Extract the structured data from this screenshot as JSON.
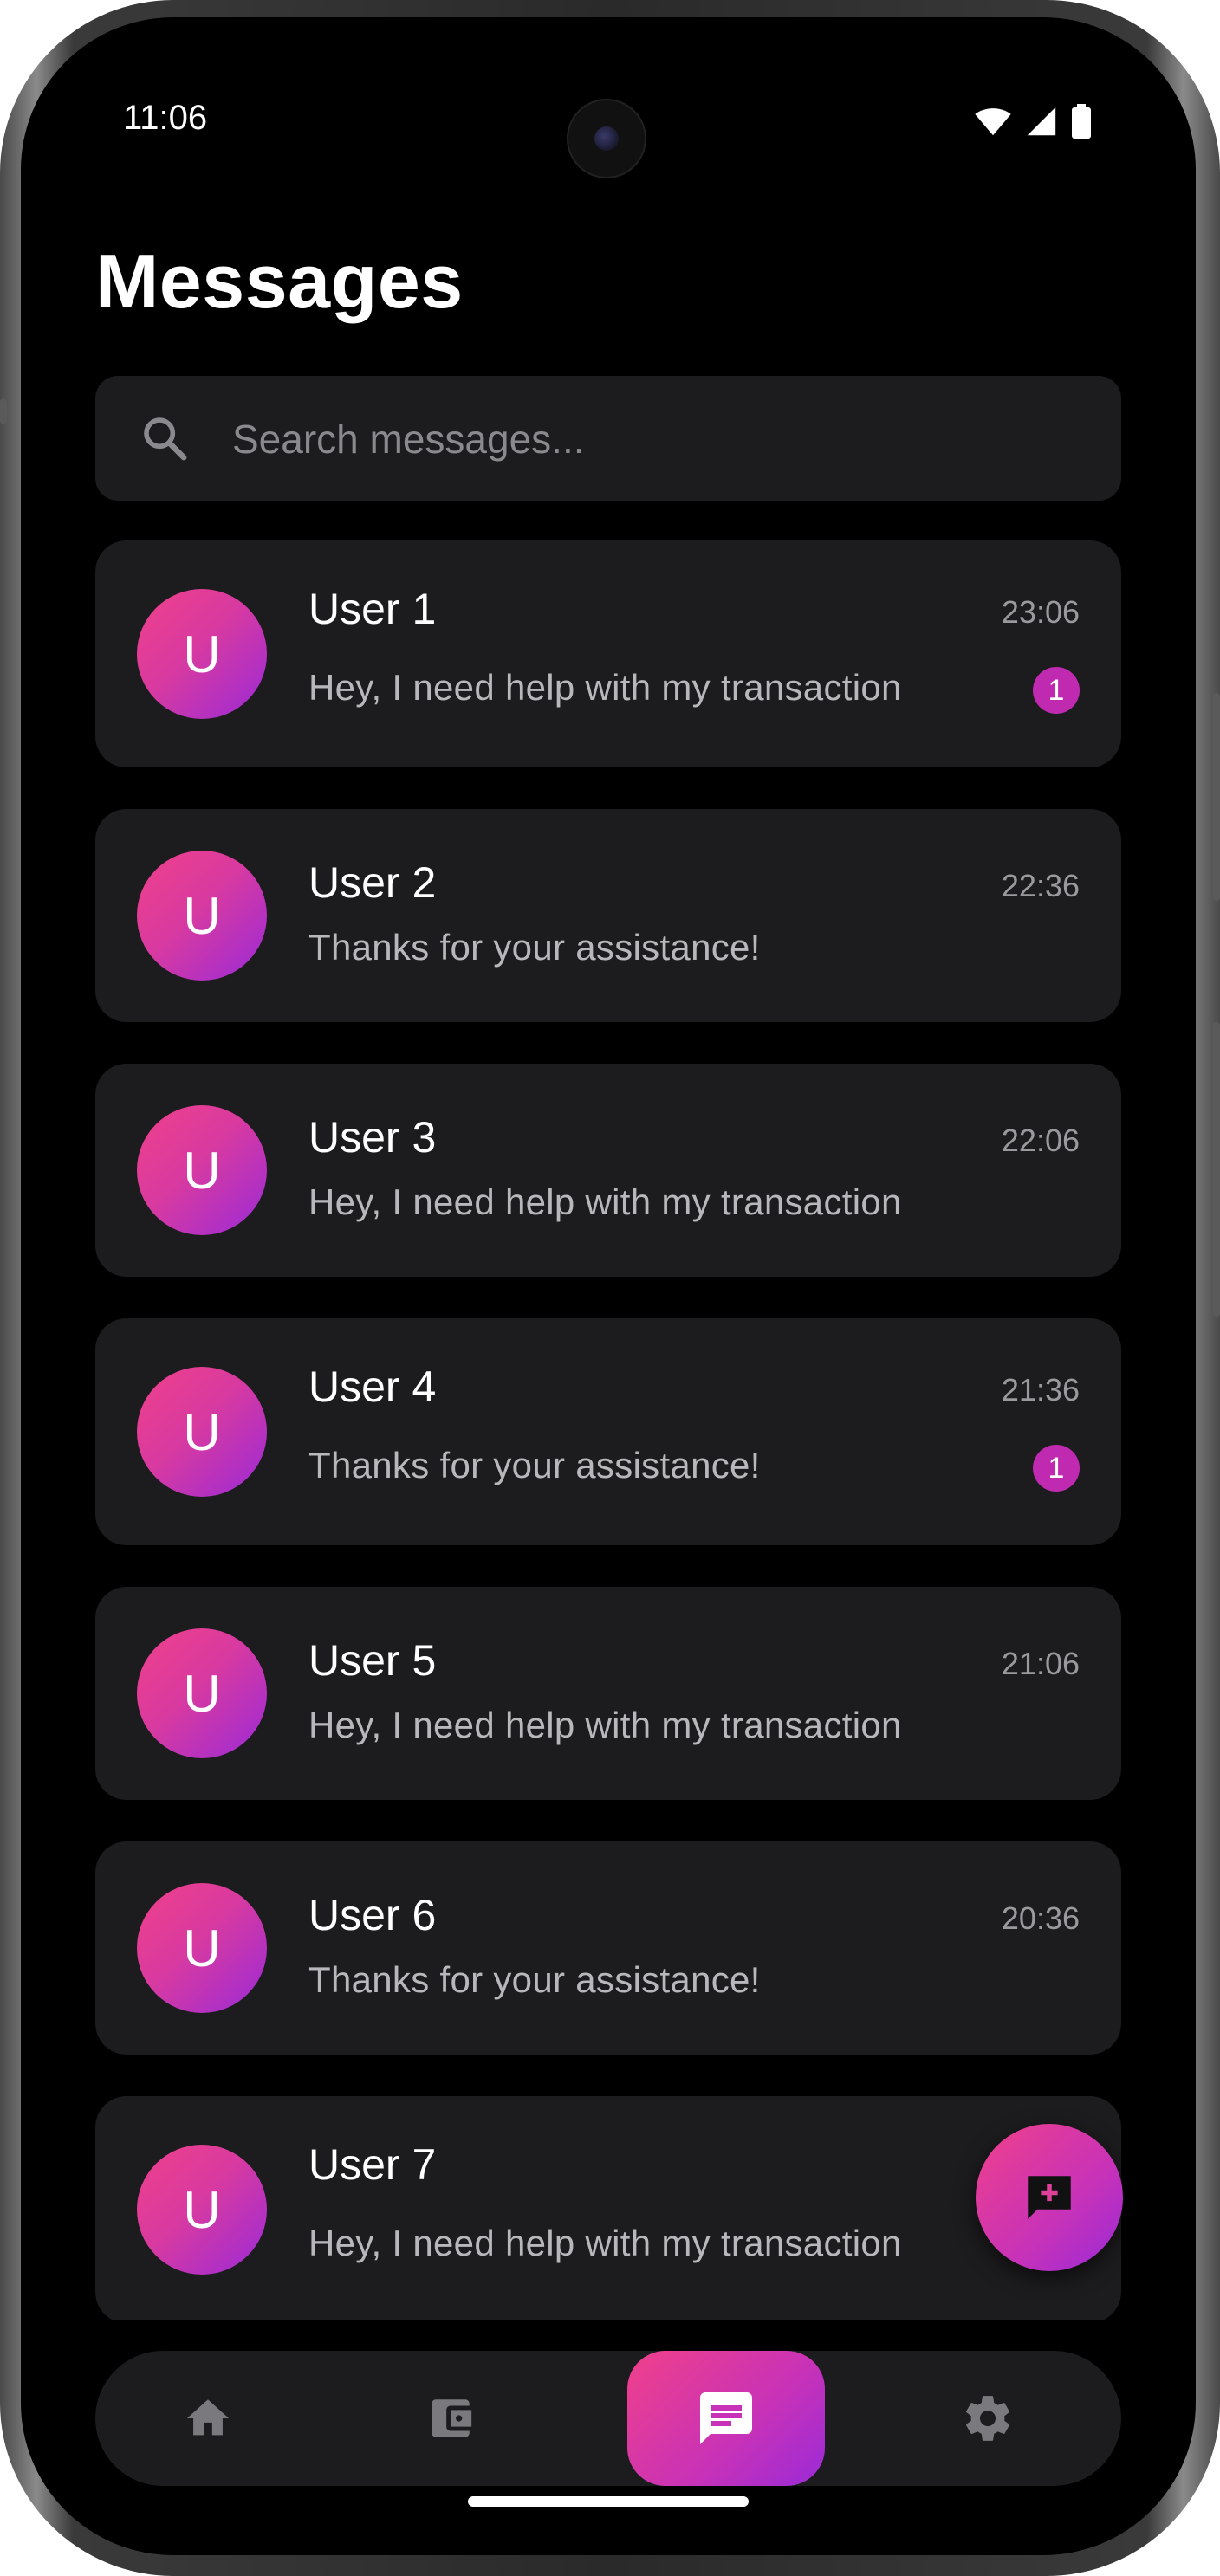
{
  "status_bar": {
    "time": "11:06"
  },
  "page": {
    "title": "Messages"
  },
  "search": {
    "placeholder": "Search messages..."
  },
  "conversations": [
    {
      "avatar_letter": "U",
      "name": "User 1",
      "time": "23:06",
      "preview": "Hey, I need help with my transaction",
      "unread": "1"
    },
    {
      "avatar_letter": "U",
      "name": "User 2",
      "time": "22:36",
      "preview": "Thanks for your assistance!",
      "unread": ""
    },
    {
      "avatar_letter": "U",
      "name": "User 3",
      "time": "22:06",
      "preview": "Hey, I need help with my transaction",
      "unread": ""
    },
    {
      "avatar_letter": "U",
      "name": "User 4",
      "time": "21:36",
      "preview": "Thanks for your assistance!",
      "unread": "1"
    },
    {
      "avatar_letter": "U",
      "name": "User 5",
      "time": "21:06",
      "preview": "Hey, I need help with my transaction",
      "unread": ""
    },
    {
      "avatar_letter": "U",
      "name": "User 6",
      "time": "20:36",
      "preview": "Thanks for your assistance!",
      "unread": ""
    },
    {
      "avatar_letter": "U",
      "name": "User 7",
      "time": "",
      "preview": "Hey, I need help with my transaction",
      "unread": ""
    }
  ],
  "fab": {
    "icon": "new-message-icon"
  },
  "nav": {
    "items": [
      {
        "icon": "home-icon",
        "active": false
      },
      {
        "icon": "wallet-icon",
        "active": false
      },
      {
        "icon": "chat-icon",
        "active": true
      },
      {
        "icon": "settings-icon",
        "active": false
      }
    ]
  },
  "colors": {
    "background": "#000000",
    "card": "#1c1c1e",
    "accent_start": "#f0408a",
    "accent_end": "#9a2ad8",
    "badge": "#c02ab0"
  }
}
